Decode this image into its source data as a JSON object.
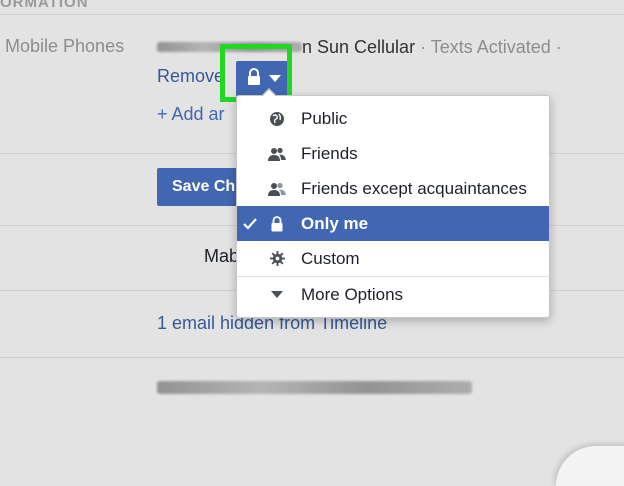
{
  "section": {
    "header": "ORMATION"
  },
  "mobile": {
    "label": "Mobile Phones",
    "number_suffix": "n Sun Cellular",
    "meta": "· Texts Activated ·",
    "remove_label": "Remove",
    "add_label": "+ Add ar"
  },
  "privacy_button": {
    "icon": "lock-icon",
    "caret": "chevron-down-icon",
    "highlight_color": "#22d722"
  },
  "audience_menu": {
    "items": [
      {
        "label": "Public",
        "icon": "globe-icon",
        "selected": false
      },
      {
        "label": "Friends",
        "icon": "friends-icon",
        "selected": false
      },
      {
        "label": "Friends except acquaintances",
        "icon": "friends-except-icon",
        "selected": false
      },
      {
        "label": "Only me",
        "icon": "lock-icon",
        "selected": true
      },
      {
        "label": "Custom",
        "icon": "gear-icon",
        "selected": false
      },
      {
        "label": "More Options",
        "icon": "caret-down-icon",
        "selected": false
      }
    ]
  },
  "buttons": {
    "save_label": "Save Ch"
  },
  "content": {
    "mab_text": "Mab",
    "email_hidden": "1 email hidden from Timeline"
  },
  "colors": {
    "accent": "#4267b2",
    "link": "#365899",
    "background": "#e3e3e3"
  }
}
